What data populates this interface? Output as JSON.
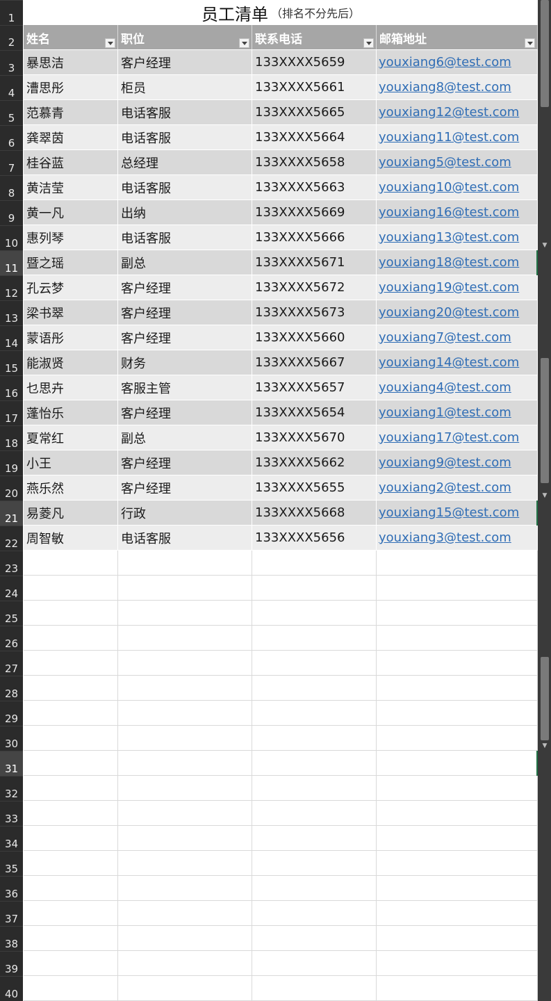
{
  "sheet": {
    "title": "员工清单",
    "subtitle": "（排名不分先后）",
    "headers": [
      "姓名",
      "职位",
      "联系电话",
      "邮箱地址"
    ],
    "rows": [
      [
        "暴思洁",
        "客户经理",
        "133XXXX5659",
        "youxiang6@test.com"
      ],
      [
        "漕思彤",
        "柜员",
        "133XXXX5661",
        "youxiang8@test.com"
      ],
      [
        "范慕青",
        "电话客服",
        "133XXXX5665",
        "youxiang12@test.com"
      ],
      [
        "龚翠茵",
        "电话客服",
        "133XXXX5664",
        "youxiang11@test.com"
      ],
      [
        "桂谷蓝",
        "总经理",
        "133XXXX5658",
        "youxiang5@test.com"
      ],
      [
        "黄洁莹",
        "电话客服",
        "133XXXX5663",
        "youxiang10@test.com"
      ],
      [
        "黄一凡",
        "出纳",
        "133XXXX5669",
        "youxiang16@test.com"
      ],
      [
        "惠列琴",
        "电话客服",
        "133XXXX5666",
        "youxiang13@test.com"
      ],
      [
        "暨之瑶",
        "副总",
        "133XXXX5671",
        "youxiang18@test.com"
      ],
      [
        "孔云梦",
        "客户经理",
        "133XXXX5672",
        "youxiang19@test.com"
      ],
      [
        "梁书翠",
        "客户经理",
        "133XXXX5673",
        "youxiang20@test.com"
      ],
      [
        "蒙语彤",
        "客户经理",
        "133XXXX5660",
        "youxiang7@test.com"
      ],
      [
        "能淑贤",
        "财务",
        "133XXXX5667",
        "youxiang14@test.com"
      ],
      [
        "乜思卉",
        "客服主管",
        "133XXXX5657",
        "youxiang4@test.com"
      ],
      [
        "蓬怡乐",
        "客户经理",
        "133XXXX5654",
        "youxiang1@test.com"
      ],
      [
        "夏常红",
        "副总",
        "133XXXX5670",
        "youxiang17@test.com"
      ],
      [
        "小王",
        "客户经理",
        "133XXXX5662",
        "youxiang9@test.com"
      ],
      [
        "燕乐然",
        "客户经理",
        "133XXXX5655",
        "youxiang2@test.com"
      ],
      [
        "易菱凡",
        "行政",
        "133XXXX5668",
        "youxiang15@test.com"
      ],
      [
        "周智敏",
        "电话客服",
        "133XXXX5656",
        "youxiang3@test.com"
      ]
    ],
    "row_numbers": [
      "1",
      "2",
      "3",
      "4",
      "5",
      "6",
      "7",
      "8",
      "9",
      "10",
      "11",
      "12",
      "13",
      "14",
      "15",
      "16",
      "17",
      "18",
      "19",
      "20",
      "21",
      "22",
      "23",
      "24",
      "25",
      "26",
      "27",
      "28",
      "29",
      "30",
      "31",
      "32",
      "33",
      "34",
      "35",
      "36",
      "37",
      "38",
      "39",
      "40"
    ],
    "selected_rows": [
      "11",
      "21",
      "31"
    ]
  },
  "colors": {
    "header_bg": "#a6a6a6",
    "band_dark": "#d9d9d9",
    "band_light": "#ededed",
    "link": "#2f6db5",
    "row_header_bg": "#2b2b2b"
  }
}
